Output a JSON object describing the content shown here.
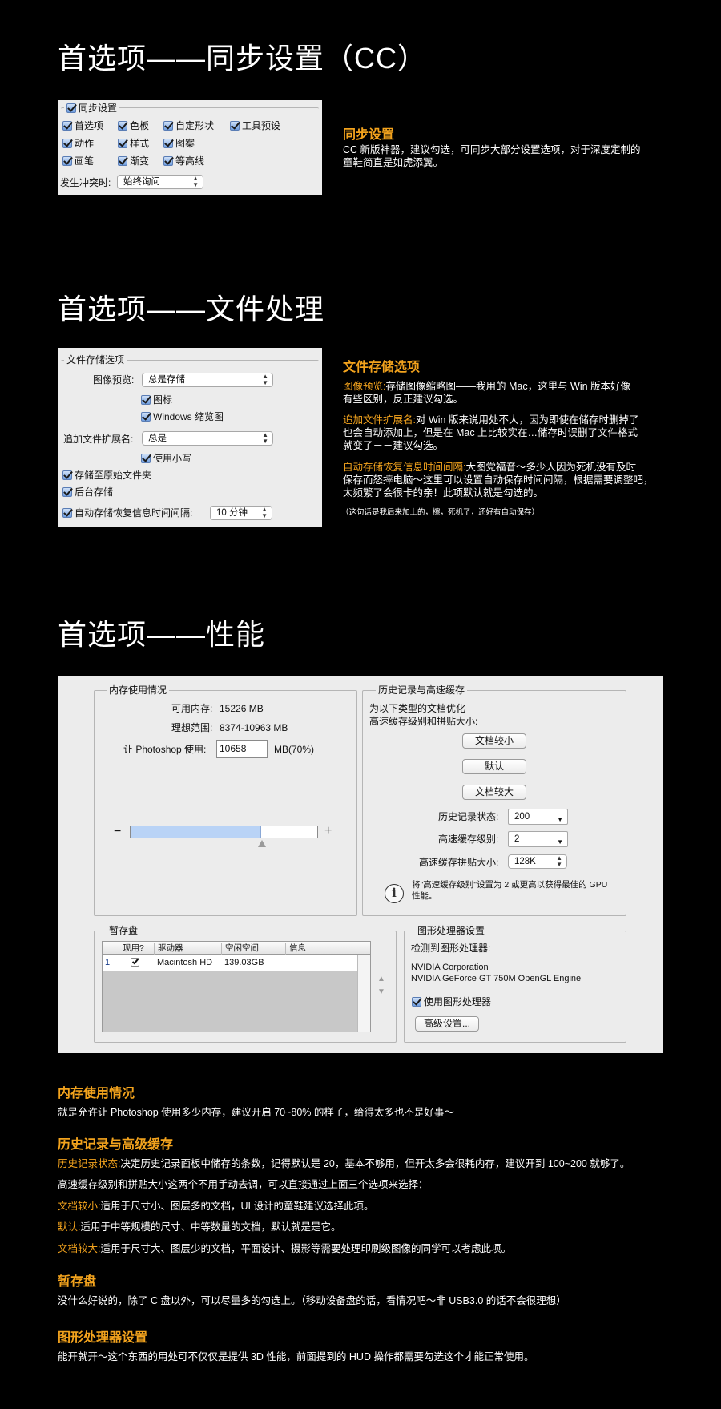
{
  "sections": {
    "sync": {
      "heading": "首选项——同步设置（CC）",
      "panel": {
        "group_label": "同步设置",
        "items": [
          "首选项",
          "色板",
          "自定形状",
          "工具预设",
          "动作",
          "样式",
          "图案",
          "画笔",
          "渐变",
          "等高线"
        ],
        "conflict_label": "发生冲突时:",
        "conflict_value": "始终询问"
      },
      "desc_title": "同步设置",
      "desc_line1": "CC 新版神器，建议勾选，可同步大部分设置选项，对于深度定制的",
      "desc_line2": "童鞋简直是如虎添翼。"
    },
    "file": {
      "heading": "首选项——文件处理",
      "panel": {
        "group_label": "文件存储选项",
        "preview_label": "图像预览:",
        "preview_value": "总是存储",
        "icon_label": "图标",
        "windows_thumb_label": "Windows 缩览图",
        "ext_label": "追加文件扩展名:",
        "ext_value": "总是",
        "lowercase_label": "使用小写",
        "save_original_label": "存储至原始文件夹",
        "background_save_label": "后台存储",
        "autosave_label": "自动存储恢复信息时间间隔:",
        "autosave_value": "10 分钟"
      },
      "desc_title": "文件存储选项",
      "p1_key": "图像预览:",
      "p1_line1": "存储图像缩略图——我用的 Mac，这里与 Win 版本好像",
      "p1_line2": "有些区别，反正建议勾选。",
      "p2_key": "追加文件扩展名:",
      "p2_line1": "对 Win 版来说用处不大，因为即使在储存时删掉了",
      "p2_line2": "也会自动添加上，但是在 Mac 上比较实在…储存时误删了文件格式",
      "p2_line3": "就变了－－建议勾选。",
      "p3_key": "自动存储恢复信息时间间隔:",
      "p3_line1": "大图党福音～多少人因为死机没有及时",
      "p3_line2": "保存而怒摔电脑～这里可以设置自动保存时间间隔，根据需要调整吧，",
      "p3_line3": "太频繁了会很卡的亲！此项默认就是勾选的。",
      "note": "（这句话是我后来加上的，擦，死机了，还好有自动保存）"
    },
    "perf": {
      "heading": "首选项——性能",
      "memory": {
        "group_label": "内存使用情况",
        "available_label": "可用内存:",
        "available_value": "15226 MB",
        "ideal_label": "理想范围:",
        "ideal_value": "8374-10963 MB",
        "let_label": "让 Photoshop 使用:",
        "let_value": "10658",
        "let_unit": "MB(70%)",
        "minus": "−",
        "plus": "+",
        "slider_fraction": 0.7
      },
      "history": {
        "group_label": "历史记录与高速缓存",
        "desc_line1": "为以下类型的文档优化",
        "desc_line2": "高速缓存级别和拼贴大小:",
        "btn_small": "文档较小",
        "btn_default": "默认",
        "btn_large": "文档较大",
        "states_label": "历史记录状态:",
        "states_value": "200",
        "levels_label": "高速缓存级别:",
        "levels_value": "2",
        "tile_label": "高速缓存拼贴大小:",
        "tile_value": "128K",
        "info_line1": "将\"高速缓存级别\"设置为 2 或更高以获得最佳的 GPU",
        "info_line2": "性能。"
      },
      "scratch": {
        "group_label": "暂存盘",
        "columns": [
          "现用?",
          "驱动器",
          "空闲空间",
          "信息"
        ],
        "row": {
          "index": "1",
          "drive": "Macintosh HD",
          "free": "139.03GB",
          "info": ""
        }
      },
      "gpu": {
        "group_label": "图形处理器设置",
        "detected_label": "检测到图形处理器:",
        "vendor": "NVIDIA Corporation",
        "model": "NVIDIA GeForce GT 750M OpenGL Engine",
        "use_gpu_label": "使用图形处理器",
        "advanced_button": "高级设置..."
      }
    },
    "notes": {
      "mem_title": "内存使用情况",
      "mem_text": "就是允许让 Photoshop 使用多少内存，建议开启 70~80% 的样子，给得太多也不是好事～",
      "hist_title": "历史记录与高级缓存",
      "hist_key": "历史记录状态:",
      "hist_text": "决定历史记录面板中储存的条数，记得默认是 20，基本不够用，但开太多会很耗内存，建议开到 100~200 就够了。",
      "hist_text2": "高速缓存级别和拼贴大小这两个不用手动去调，可以直接通过上面三个选项来选择：",
      "small_key": "文档较小:",
      "small_text": "适用于尺寸小、图层多的文档，UI 设计的童鞋建议选择此项。",
      "default_key": "默认:",
      "default_text": "适用于中等规模的尺寸、中等数量的文档，默认就是是它。",
      "large_key": "文档较大:",
      "large_text": "适用于尺寸大、图层少的文档，平面设计、摄影等需要处理印刷级图像的同学可以考虑此项。",
      "scratch_title": "暂存盘",
      "scratch_text": "没什么好说的，除了 C 盘以外，可以尽量多的勾选上。（移动设备盘的话，看情况吧～非 USB3.0 的话不会很理想）",
      "gpu_title": "图形处理器设置",
      "gpu_text": "能开就开～这个东西的用处可不仅仅是提供 3D 性能，前面提到的 HUD 操作都需要勾选这个才能正常使用。"
    }
  },
  "colors": {
    "accent": "#f3a31d",
    "background": "#000000",
    "panel": "#ececec",
    "slider_fill": "#b9d3f6"
  }
}
